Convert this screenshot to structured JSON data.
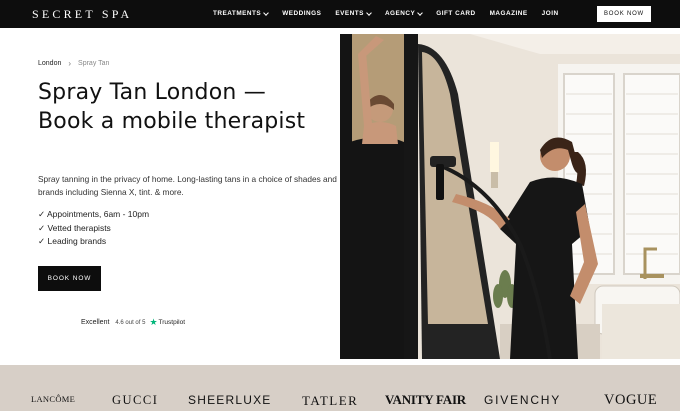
{
  "nav": {
    "logo": "SECRET SPA",
    "links": [
      "TREATMENTS",
      "WEDDINGS",
      "EVENTS",
      "AGENCY",
      "GIFT CARD",
      "MAGAZINE",
      "JOIN"
    ],
    "book_label": "BOOK NOW"
  },
  "breadcrumb": {
    "parent": "London",
    "current": "Spray Tan"
  },
  "hero": {
    "title": "Spray Tan London — Book a mobile therapist",
    "intro": "Spray tanning in the privacy of home. Long-lasting tans in a choice of shades and brands including Sienna X, tint. & more.",
    "features": [
      "✓ Appointments, 6am - 10pm",
      "✓ Vetted therapists",
      "✓ Leading brands"
    ],
    "cta_label": "BOOK NOW"
  },
  "trustpilot": {
    "label": "Excellent",
    "rating": "4.6 out of 5",
    "brand": "Trustpilot"
  },
  "press_logos": [
    "LANCÔME",
    "GUCCI",
    "SHEERLUXE",
    "TATLER",
    "VANITY FAIR",
    "GIVENCHY",
    "VOGUE"
  ],
  "colors": {
    "nav_bg": "#0d0d0d",
    "strip_bg": "#d7cfc7",
    "trustpilot_green": "#00b67a"
  }
}
